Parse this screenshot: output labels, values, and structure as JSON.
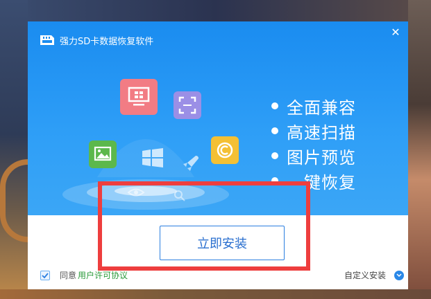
{
  "window": {
    "title": "强力SD卡数据恢复软件",
    "close_glyph": "✕"
  },
  "features": [
    {
      "label": "全面兼容"
    },
    {
      "label": "高速扫描"
    },
    {
      "label": "图片预览"
    },
    {
      "label": "一键恢复"
    }
  ],
  "install_button": {
    "label": "立即安装"
  },
  "agreement": {
    "checked": true,
    "prefix": "同意",
    "link": "用户许可协议"
  },
  "custom_install": {
    "label": "自定义安装",
    "icon": "chevron-down-icon"
  },
  "colors": {
    "hero_blue": "#1a8cf0",
    "button_text": "#2a6fcf",
    "link_green": "#2a9a3a",
    "annotation_red": "#ee3e3e"
  }
}
